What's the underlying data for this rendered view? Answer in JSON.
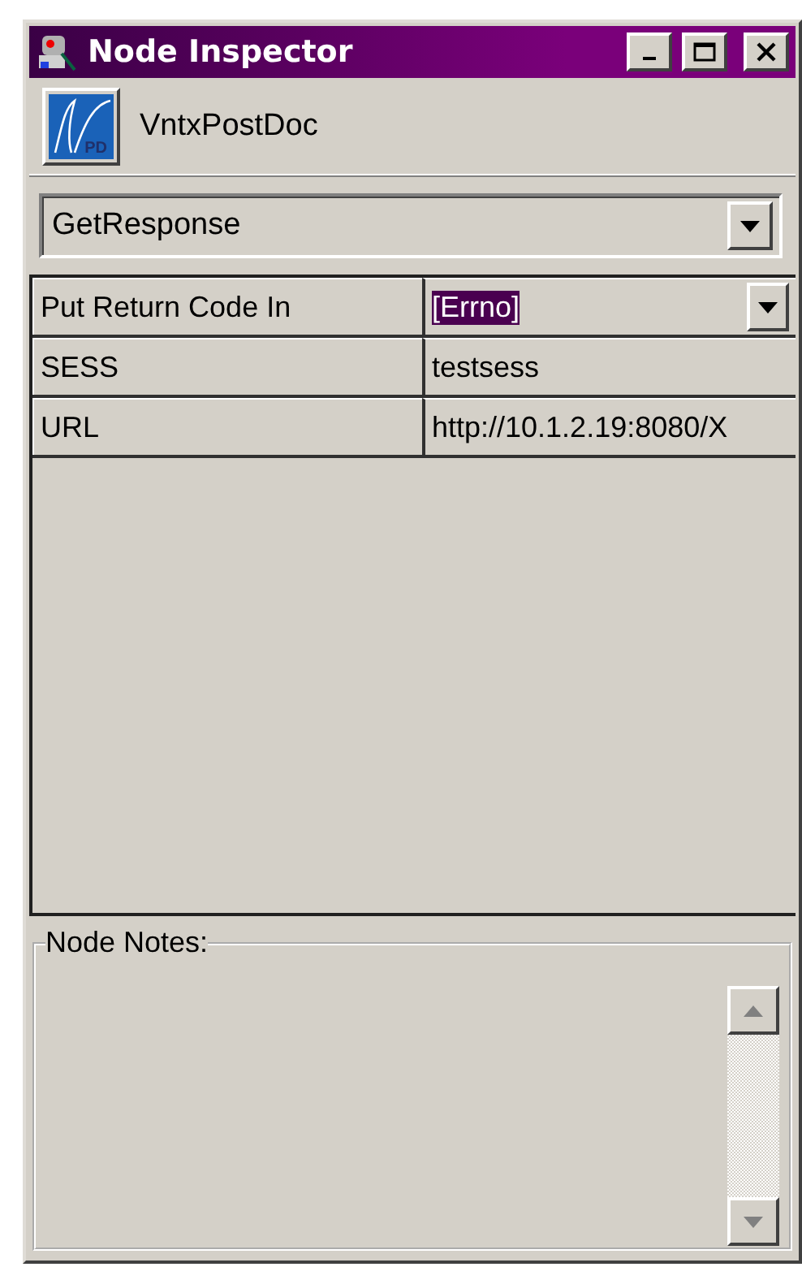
{
  "window": {
    "title": "Node Inspector"
  },
  "node": {
    "name": "VntxPostDoc",
    "icon_label": "PD"
  },
  "method_select": {
    "value": "GetResponse"
  },
  "properties": [
    {
      "name": "Put Return Code In",
      "value": "[Errno]",
      "kind": "dropdown",
      "highlighted": true
    },
    {
      "name": "SESS",
      "value": "testsess",
      "kind": "text",
      "highlighted": false
    },
    {
      "name": "URL",
      "value": "http://10.1.2.19:8080/X",
      "kind": "text",
      "highlighted": false
    }
  ],
  "notes": {
    "label": "Node Notes:",
    "scroll_up_disabled": true,
    "scroll_down_disabled": true
  }
}
